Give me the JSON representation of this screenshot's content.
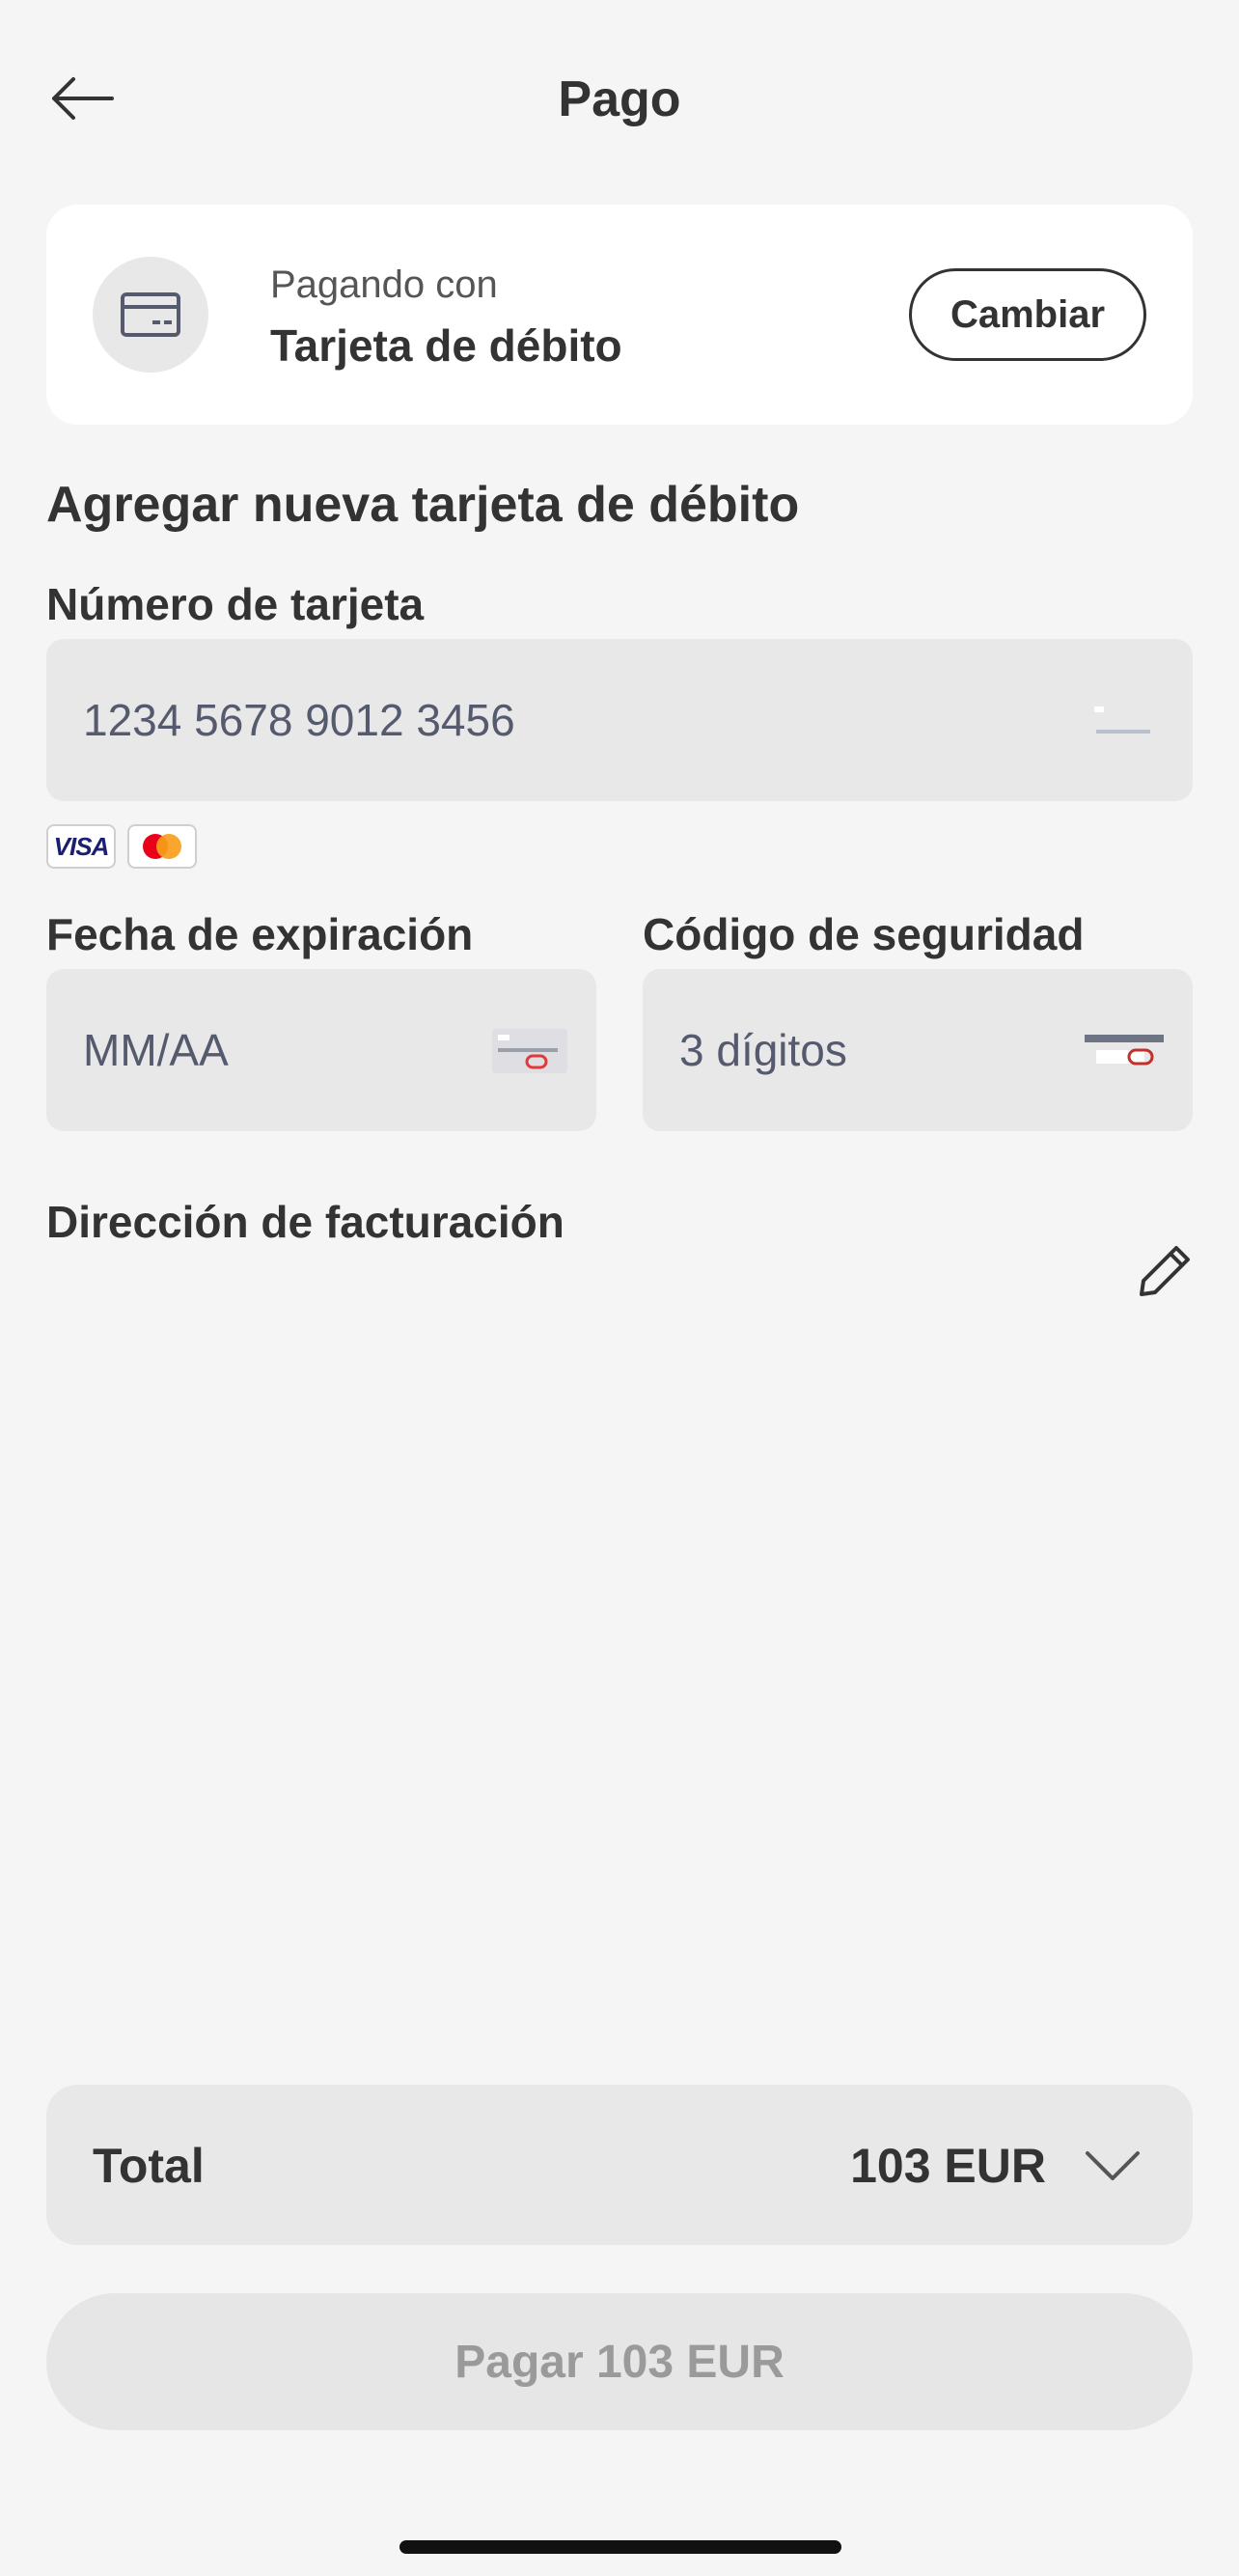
{
  "header": {
    "title": "Pago",
    "back_icon": "arrow-left-icon"
  },
  "payment_method": {
    "label": "Pagando con",
    "method": "Tarjeta de débito",
    "change_label": "Cambiar",
    "icon": "credit-card-icon"
  },
  "form": {
    "section_title": "Agregar nueva tarjeta de débito",
    "card_number": {
      "label": "Número de tarjeta",
      "placeholder": "1234 5678 9012 3456"
    },
    "accepted_brands": [
      "VISA",
      "Mastercard"
    ],
    "expiry": {
      "label": "Fecha de expiración",
      "placeholder": "MM/AA"
    },
    "security_code": {
      "label": "Código de seguridad",
      "placeholder": "3 dígitos"
    },
    "billing_address": {
      "label": "Dirección de facturación",
      "edit_icon": "pencil-icon"
    }
  },
  "summary": {
    "total_label": "Total",
    "total_amount": "103 EUR",
    "expand_icon": "chevron-down-icon"
  },
  "pay_button": {
    "label": "Pagar 103 EUR"
  },
  "colors": {
    "background": "#f5f5f5",
    "card": "#ffffff",
    "input": "#e8e8e8",
    "text": "#333333",
    "disabled_text": "#9a9a9a",
    "visa_blue": "#1a1f71",
    "mc_red": "#eb001b",
    "mc_orange": "#f79e1b"
  }
}
